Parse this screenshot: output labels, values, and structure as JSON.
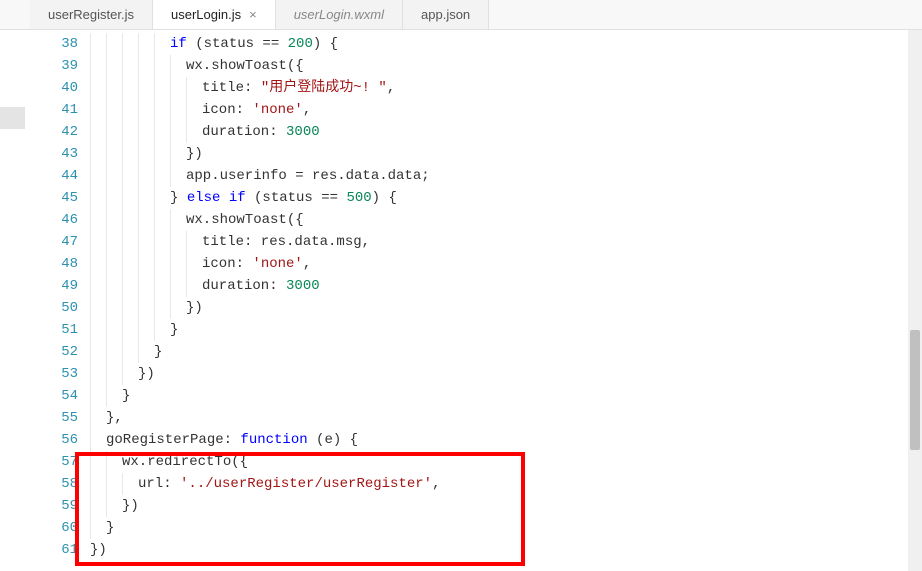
{
  "tabs": [
    {
      "label": "userRegister.js",
      "active": false,
      "italic": false,
      "closeable": false
    },
    {
      "label": "userLogin.js",
      "active": true,
      "italic": false,
      "closeable": true
    },
    {
      "label": "userLogin.wxml",
      "active": false,
      "italic": true,
      "closeable": false
    },
    {
      "label": "app.json",
      "active": false,
      "italic": false,
      "closeable": false
    }
  ],
  "close_glyph": "×",
  "first_line": 38,
  "code_lines": [
    {
      "n": 38,
      "indent": 5,
      "tokens": [
        {
          "t": "if",
          "c": "kw"
        },
        {
          "t": " (status == ",
          "c": "punct"
        },
        {
          "t": "200",
          "c": "num"
        },
        {
          "t": ") {",
          "c": "punct"
        }
      ]
    },
    {
      "n": 39,
      "indent": 6,
      "tokens": [
        {
          "t": "wx.showToast({",
          "c": "ident"
        }
      ]
    },
    {
      "n": 40,
      "indent": 7,
      "tokens": [
        {
          "t": "title: ",
          "c": "ident"
        },
        {
          "t": "\"用户登陆成功~! \"",
          "c": "str"
        },
        {
          "t": ",",
          "c": "punct"
        }
      ]
    },
    {
      "n": 41,
      "indent": 7,
      "tokens": [
        {
          "t": "icon: ",
          "c": "ident"
        },
        {
          "t": "'none'",
          "c": "str"
        },
        {
          "t": ",",
          "c": "punct"
        }
      ]
    },
    {
      "n": 42,
      "indent": 7,
      "tokens": [
        {
          "t": "duration: ",
          "c": "ident"
        },
        {
          "t": "3000",
          "c": "num"
        }
      ]
    },
    {
      "n": 43,
      "indent": 6,
      "tokens": [
        {
          "t": "})",
          "c": "punct"
        }
      ]
    },
    {
      "n": 44,
      "indent": 6,
      "tokens": [
        {
          "t": "app.userinfo = res.data.data;",
          "c": "ident"
        }
      ]
    },
    {
      "n": 45,
      "indent": 5,
      "tokens": [
        {
          "t": "} ",
          "c": "punct"
        },
        {
          "t": "else if",
          "c": "kw"
        },
        {
          "t": " (status == ",
          "c": "punct"
        },
        {
          "t": "500",
          "c": "num"
        },
        {
          "t": ") {",
          "c": "punct"
        }
      ]
    },
    {
      "n": 46,
      "indent": 6,
      "tokens": [
        {
          "t": "wx.showToast({",
          "c": "ident"
        }
      ]
    },
    {
      "n": 47,
      "indent": 7,
      "tokens": [
        {
          "t": "title: res.data.msg,",
          "c": "ident"
        }
      ]
    },
    {
      "n": 48,
      "indent": 7,
      "tokens": [
        {
          "t": "icon: ",
          "c": "ident"
        },
        {
          "t": "'none'",
          "c": "str"
        },
        {
          "t": ",",
          "c": "punct"
        }
      ]
    },
    {
      "n": 49,
      "indent": 7,
      "tokens": [
        {
          "t": "duration: ",
          "c": "ident"
        },
        {
          "t": "3000",
          "c": "num"
        }
      ]
    },
    {
      "n": 50,
      "indent": 6,
      "tokens": [
        {
          "t": "})",
          "c": "punct"
        }
      ]
    },
    {
      "n": 51,
      "indent": 5,
      "tokens": [
        {
          "t": "}",
          "c": "punct"
        }
      ]
    },
    {
      "n": 52,
      "indent": 4,
      "tokens": [
        {
          "t": "}",
          "c": "punct"
        }
      ]
    },
    {
      "n": 53,
      "indent": 3,
      "tokens": [
        {
          "t": "})",
          "c": "punct"
        }
      ]
    },
    {
      "n": 54,
      "indent": 2,
      "tokens": [
        {
          "t": "}",
          "c": "punct"
        }
      ]
    },
    {
      "n": 55,
      "indent": 1,
      "tokens": [
        {
          "t": "},",
          "c": "punct"
        }
      ]
    },
    {
      "n": 56,
      "indent": 1,
      "tokens": [
        {
          "t": "goRegisterPage: ",
          "c": "ident"
        },
        {
          "t": "function",
          "c": "fn"
        },
        {
          "t": " (e) {",
          "c": "punct"
        }
      ]
    },
    {
      "n": 57,
      "indent": 2,
      "tokens": [
        {
          "t": "wx.redirectTo({",
          "c": "ident"
        }
      ]
    },
    {
      "n": 58,
      "indent": 3,
      "tokens": [
        {
          "t": "url: ",
          "c": "ident"
        },
        {
          "t": "'../userRegister/userRegister'",
          "c": "str"
        },
        {
          "t": ",",
          "c": "punct"
        }
      ]
    },
    {
      "n": 59,
      "indent": 2,
      "tokens": [
        {
          "t": "})",
          "c": "punct"
        }
      ]
    },
    {
      "n": 60,
      "indent": 1,
      "tokens": [
        {
          "t": "}",
          "c": "punct"
        }
      ]
    },
    {
      "n": 61,
      "indent": 0,
      "tokens": [
        {
          "t": "})",
          "c": "punct"
        }
      ]
    }
  ]
}
